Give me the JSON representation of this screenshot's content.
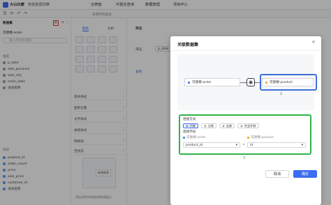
{
  "topbar": {
    "app_name": "大山石磨",
    "app_subtitle": "智能数据洞察",
    "nav": [
      "仪表盘",
      "可视化查询",
      "数据管理",
      "项目中心"
    ]
  },
  "toolbar": {
    "title": "未保存的查询"
  },
  "left_panel": {
    "header": "数据集",
    "dataset": "可建模-order",
    "search_placeholder": "输入字段名搜索",
    "dims_label": "维度",
    "dimensions": [
      "p_date",
      "sale_province",
      "sale_city",
      "order_date",
      "试试名称"
    ],
    "metrics_label": "指标",
    "metrics": [
      "product_id",
      "order_count",
      "price",
      "sale_price",
      "customer_id",
      "试试名称"
    ]
  },
  "middle_panel": {
    "tabs": [
      "图表",
      "分析"
    ],
    "sections": [
      "基本样式",
      "图例位置",
      "文字样式",
      "表格样式",
      "网格线",
      "空状态"
    ],
    "empty_hint": "请先选择字段或绘制图表展示",
    "tooltip": "新建图表"
  },
  "right_panel": {
    "header": "筛选",
    "filter_label": "筛选",
    "filter_value": "p_date",
    "apply_label": "查询"
  },
  "modal": {
    "title": "关联数据集",
    "left_node": "可建模-order",
    "right_node": "可建模-product",
    "join_method_label": "连接方式",
    "join_options": [
      "内联",
      "左联",
      "右联",
      "完全外联"
    ],
    "join_field_label": "连接字段",
    "left_dataset": "可建模-order",
    "right_dataset": "可建模-product",
    "left_field": "product_id",
    "operator": "=",
    "right_field": "id",
    "cancel_label": "取消",
    "ok_label": "确定",
    "annotation_2": "2",
    "annotation_3": "3"
  },
  "colors": {
    "accent": "#3b6df0",
    "highlight_red": "#e53935",
    "highlight_blue": "#3d6fd8",
    "highlight_green": "#2fb34a"
  }
}
